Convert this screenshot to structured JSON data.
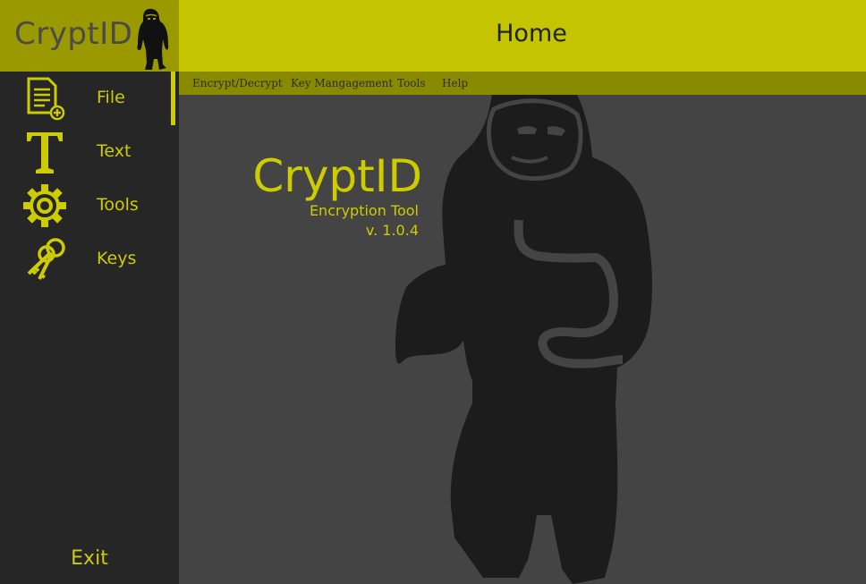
{
  "brand": {
    "name": "CryptID",
    "logo_icon": "bigfoot-logo-icon"
  },
  "sidebar": {
    "items": [
      {
        "label": "File",
        "icon": "document-add-icon",
        "active": true
      },
      {
        "label": "Text",
        "icon": "text-t-icon",
        "active": false
      },
      {
        "label": "Tools",
        "icon": "gear-icon",
        "active": false
      },
      {
        "label": "Keys",
        "icon": "keys-icon",
        "active": false
      }
    ],
    "exit_label": "Exit"
  },
  "header": {
    "title": "Home"
  },
  "menubar": {
    "items": [
      "Encrypt/Decrypt",
      "Key Mangagement",
      "Tools",
      "Help"
    ]
  },
  "main": {
    "app_title": "CryptID",
    "app_subtitle": "Encryption Tool",
    "app_version": "v. 1.0.4"
  },
  "colors": {
    "accent": "#cccc00",
    "header_bg": "#c4c400",
    "brand_bg": "#9a9a00",
    "menubar_bg": "#8a8a00",
    "sidebar_bg": "#262626",
    "main_bg": "#444444"
  }
}
